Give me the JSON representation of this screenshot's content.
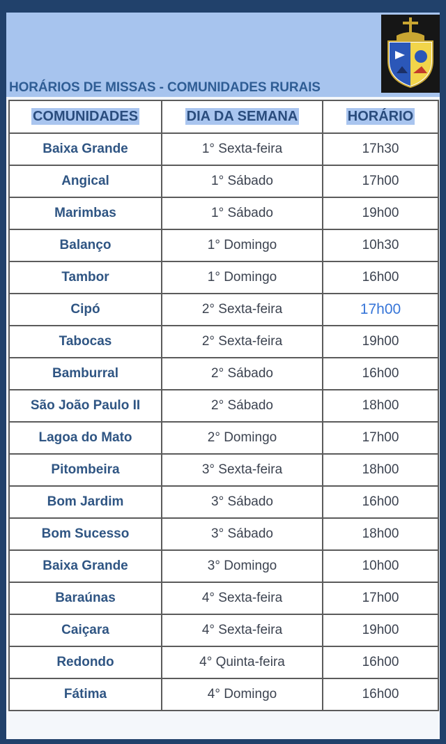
{
  "header": {
    "title": "HORÁRIOS DE MISSAS - COMUNIDADES RURAIS",
    "logo_icon": "parish-coat-of-arms-icon",
    "colors": {
      "banner": "#a7c4ee",
      "title": "#2f5d94",
      "background": "#21416b"
    }
  },
  "table": {
    "columns": [
      "COMUNIDADES",
      "DIA DA SEMANA",
      "HORÁRIO"
    ],
    "rows": [
      {
        "community": "Baixa Grande",
        "day": "1° Sexta-feira",
        "time": "17h30"
      },
      {
        "community": "Angical",
        "day": "1° Sábado",
        "time": "17h00"
      },
      {
        "community": "Marimbas",
        "day": "1° Sábado",
        "time": "19h00"
      },
      {
        "community": "Balanço",
        "day": "1° Domingo",
        "time": "10h30"
      },
      {
        "community": "Tambor",
        "day": "1° Domingo",
        "time": "16h00"
      },
      {
        "community": "Cipó",
        "day": "2° Sexta-feira",
        "time": "17h00",
        "accent": true
      },
      {
        "community": "Tabocas",
        "day": "2° Sexta-feira",
        "time": "19h00"
      },
      {
        "community": "Bamburral",
        "day": "2° Sábado",
        "time": "16h00"
      },
      {
        "community": "São João Paulo II",
        "day": "2° Sábado",
        "time": "18h00"
      },
      {
        "community": "Lagoa do Mato",
        "day": "2° Domingo",
        "time": "17h00"
      },
      {
        "community": "Pitombeira",
        "day": "3° Sexta-feira",
        "time": "18h00"
      },
      {
        "community": "Bom Jardim",
        "day": "3° Sábado",
        "time": "16h00"
      },
      {
        "community": "Bom Sucesso",
        "day": "3° Sábado",
        "time": "18h00"
      },
      {
        "community": "Baixa Grande",
        "day": "3° Domingo",
        "time": "10h00"
      },
      {
        "community": "Baraúnas",
        "day": "4° Sexta-feira",
        "time": "17h00"
      },
      {
        "community": "Caiçara",
        "day": "4° Sexta-feira",
        "time": "19h00"
      },
      {
        "community": "Redondo",
        "day": "4° Quinta-feira",
        "time": "16h00"
      },
      {
        "community": "Fátima",
        "day": "4° Domingo",
        "time": "16h00"
      }
    ]
  }
}
